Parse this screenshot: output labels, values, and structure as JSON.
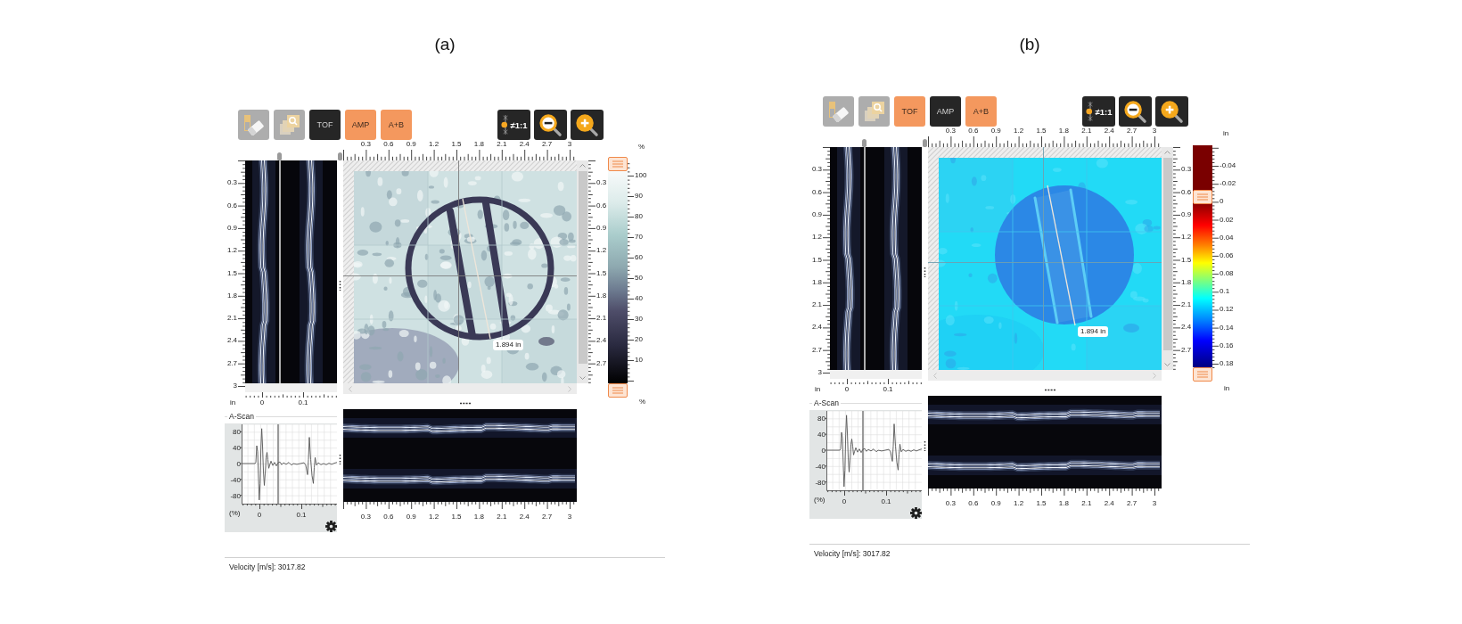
{
  "panels": [
    {
      "caption": "(a)",
      "tools": [
        {
          "kind": "eraser",
          "disabled": true
        },
        {
          "kind": "zoom_region",
          "disabled": true
        }
      ],
      "modes": [
        {
          "label": "TOF",
          "selected": false
        },
        {
          "label": "AMP",
          "selected": true
        },
        {
          "label": "A+B",
          "selected": true
        }
      ],
      "aspect_button": {
        "label": "≠1:1"
      },
      "c_scan": {
        "x_axis": [
          "0.3",
          "0.6",
          "0.9",
          "1.2",
          "1.5",
          "1.8",
          "2.1",
          "2.4",
          "2.7",
          "3"
        ],
        "y_axis": [
          "0.3",
          "0.6",
          "0.9",
          "1.2",
          "1.5",
          "1.8",
          "2.1",
          "2.4",
          "2.7"
        ],
        "measurement": "1.894 in"
      },
      "b_scan_side": {
        "y_axis": [
          "0.3",
          "0.6",
          "0.9",
          "1.2",
          "1.5",
          "1.8",
          "2.1",
          "2.4",
          "2.7",
          "3"
        ],
        "x_unit": "in",
        "x_axis": [
          "0",
          "0.1"
        ]
      },
      "color_scale": {
        "kind": "amplitude",
        "top_unit": "%",
        "bottom_unit": "%",
        "labels": [
          "100",
          "90",
          "80",
          "70",
          "60",
          "50",
          "40",
          "30",
          "20",
          "10"
        ],
        "upper_handle": {
          "level": 1
        },
        "lower_handle": {
          "level": 0
        }
      },
      "a_scan": {
        "title": "A-Scan",
        "y_axis": [
          "80",
          "40",
          "0",
          "-40",
          "-80"
        ],
        "y_unit": "(%)",
        "x_axis": [
          "0",
          "0.1"
        ]
      },
      "b_scan_bottom": {
        "x_axis": [
          "0.3",
          "0.6",
          "0.9",
          "1.2",
          "1.5",
          "1.8",
          "2.1",
          "2.4",
          "2.7",
          "3"
        ]
      },
      "status": "Velocity [m/s]: 3017.82"
    },
    {
      "caption": "(b)",
      "tools": [
        {
          "kind": "eraser",
          "disabled": true
        },
        {
          "kind": "zoom_region",
          "disabled": true
        }
      ],
      "modes": [
        {
          "label": "TOF",
          "selected": true
        },
        {
          "label": "AMP",
          "selected": false
        },
        {
          "label": "A+B",
          "selected": true
        }
      ],
      "aspect_button": {
        "label": "≠1:1"
      },
      "c_scan": {
        "x_axis": [
          "0.3",
          "0.6",
          "0.9",
          "1.2",
          "1.5",
          "1.8",
          "2.1",
          "2.4",
          "2.7",
          "3"
        ],
        "y_axis": [
          "0.3",
          "0.6",
          "0.9",
          "1.2",
          "1.5",
          "1.8",
          "2.1",
          "2.4",
          "2.7"
        ],
        "measurement": "1.894 in"
      },
      "b_scan_side": {
        "y_axis": [
          "0.3",
          "0.6",
          "0.9",
          "1.2",
          "1.5",
          "1.8",
          "2.1",
          "2.4",
          "2.7",
          "3"
        ],
        "x_unit": "in",
        "x_axis": [
          "0",
          "0.1"
        ]
      },
      "color_scale": {
        "kind": "thickness",
        "top_unit": "in",
        "bottom_unit": "in",
        "labels": [
          "-0.04",
          "-0.02",
          "0",
          "0.02",
          "0.04",
          "0.06",
          "0.08",
          "0.1",
          "0.12",
          "0.14",
          "0.16",
          "0.18"
        ],
        "upper_handle": {
          "level": 0.75
        },
        "lower_handle": {
          "level": 0
        }
      },
      "a_scan": {
        "title": "A-Scan",
        "y_axis": [
          "80",
          "40",
          "0",
          "-40",
          "-80"
        ],
        "y_unit": "(%)",
        "x_axis": [
          "0",
          "0.1"
        ]
      },
      "b_scan_bottom": {
        "x_axis": [
          "0.3",
          "0.6",
          "0.9",
          "1.2",
          "1.5",
          "1.8",
          "2.1",
          "2.4",
          "2.7",
          "3"
        ]
      },
      "status": "Velocity [m/s]: 3017.82"
    }
  ]
}
